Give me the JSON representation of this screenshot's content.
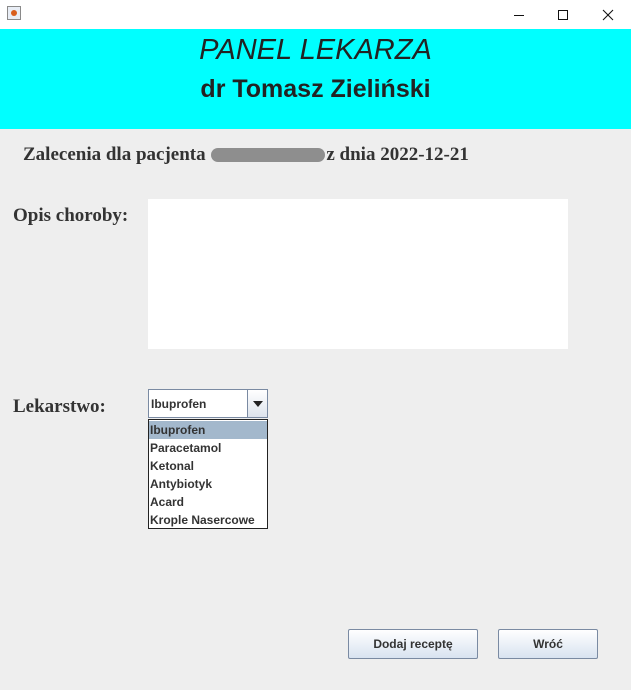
{
  "window": {
    "app_icon": "java-icon",
    "controls": [
      "minimize-icon",
      "maximize-icon",
      "close-icon"
    ]
  },
  "header": {
    "title": "PANEL LEKARZA",
    "doctor": "dr Tomasz Zieliński",
    "background": "#00ffff"
  },
  "recommendation": {
    "prefix": "Zalecenia dla pacjenta",
    "suffix": "z dnia 2022-12-21"
  },
  "form": {
    "description_label": "Opis choroby:",
    "description_value": "",
    "medicine_label": "Lekarstwo:",
    "medicine_selected": "Ibuprofen",
    "medicine_options": [
      "Ibuprofen",
      "Paracetamol",
      "Ketonal",
      "Antybiotyk",
      "Acard",
      "Krople Nasercowe"
    ]
  },
  "buttons": {
    "add_prescription": "Dodaj receptę",
    "back": "Wróć"
  },
  "colors": {
    "selection": "#a3b8cc"
  }
}
